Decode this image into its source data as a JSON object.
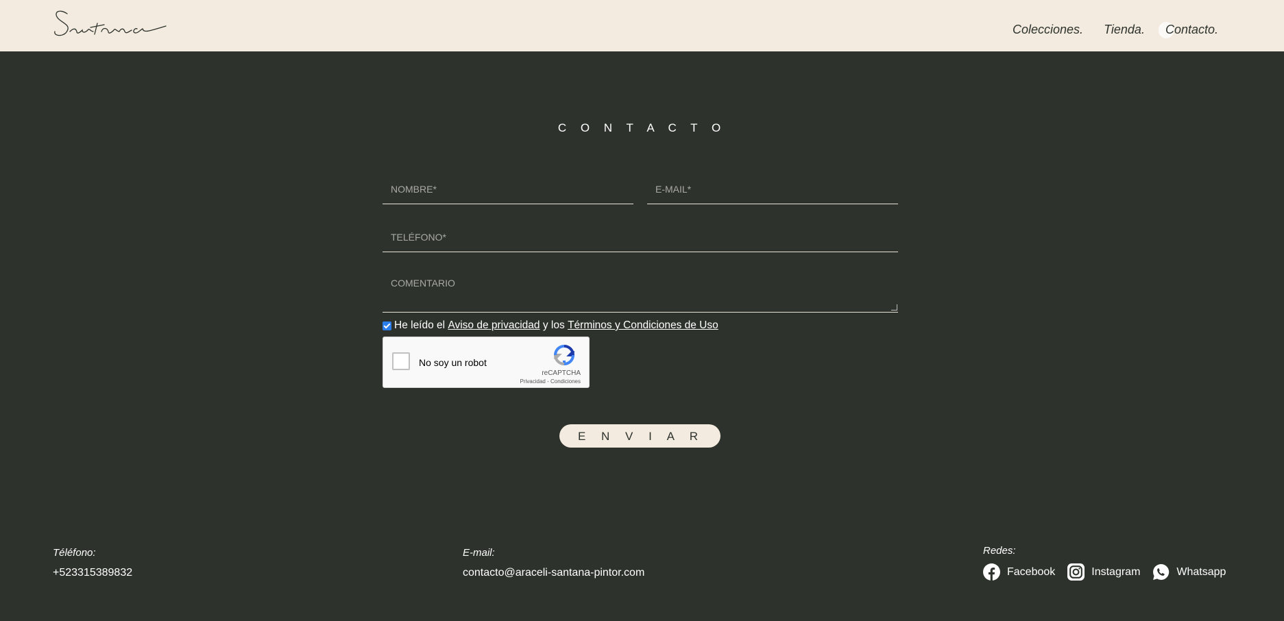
{
  "header": {
    "logo_text": "Santana",
    "nav": [
      {
        "label": "Colecciones."
      },
      {
        "label": "Tienda."
      },
      {
        "label": "Contacto."
      }
    ]
  },
  "contact": {
    "title": "C O N T A C T O",
    "fields": {
      "nombre_placeholder": "NOMBRE*",
      "email_placeholder": "E-MAIL*",
      "telefono_placeholder": "TELÉFONO*",
      "comentario_placeholder": "COMENTARIO"
    },
    "consent": {
      "checked": true,
      "prefix": "He leído el",
      "privacy_link": "Aviso de privacidad",
      "middle": "y los",
      "terms_link": "Términos y Condiciones de Uso"
    },
    "recaptcha": {
      "label": "No soy un robot",
      "brand": "reCAPTCHA",
      "links": "Privacidad - Condiciones"
    },
    "submit_label": "E N V I A R"
  },
  "footer": {
    "phone_label": "Téléfono:",
    "phone_value": "+523315389832",
    "email_label": "E-mail:",
    "email_value": "contacto@araceli-santana-pintor.com",
    "social_label": "Redes:",
    "social": [
      {
        "label": "Facebook",
        "icon": "facebook-icon"
      },
      {
        "label": "Instagram",
        "icon": "instagram-icon"
      },
      {
        "label": "Whatsapp",
        "icon": "whatsapp-icon"
      }
    ]
  },
  "colors": {
    "background": "#2d322c",
    "header_bg": "#f3ebe0",
    "checkbox_accent": "#2b7de9"
  }
}
